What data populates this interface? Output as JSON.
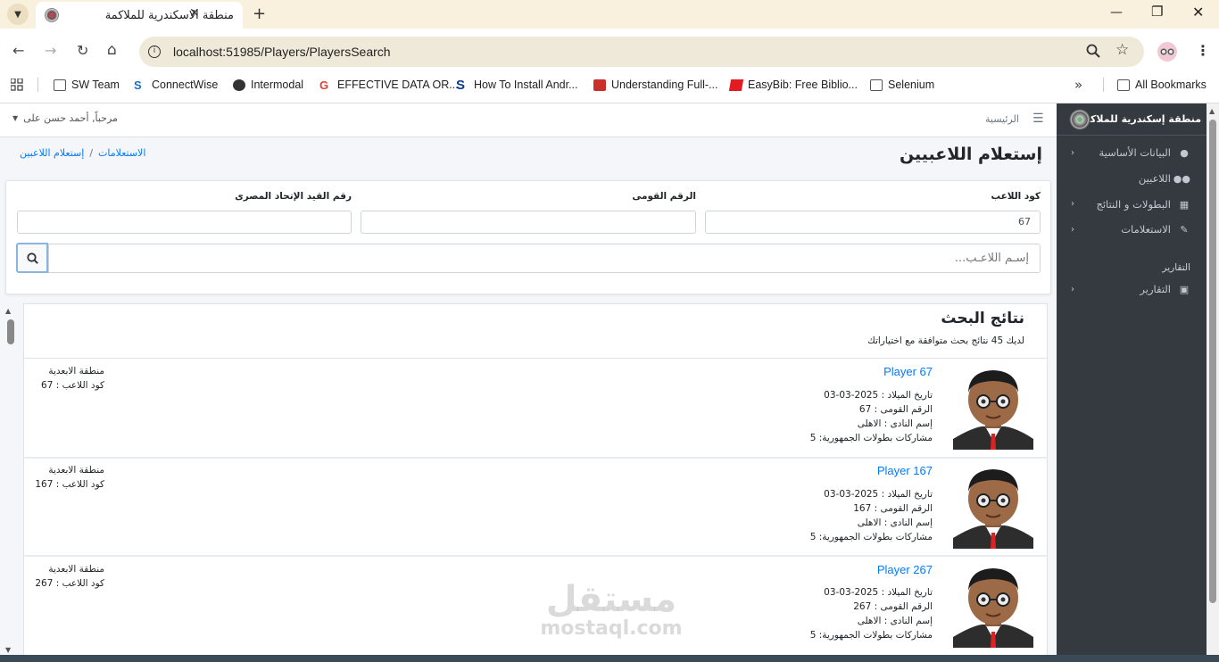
{
  "browser": {
    "tab_title": "منطقة الاسكندرية للملاكمة",
    "url": "localhost:51985/Players/PlayersSearch",
    "bookmarks": [
      "SW Team",
      "ConnectWise",
      "Intermodal",
      "EFFECTIVE DATA OR...",
      "How To Install Andr...",
      "Understanding Full-...",
      "EasyBib: Free Biblio...",
      "Selenium"
    ],
    "all_bookmarks": "All Bookmarks"
  },
  "sidebar": {
    "brand": "منطقة إسكندرية للملاكمة",
    "items": [
      {
        "label": "البيانات الأساسية",
        "icon": "dashboard-icon",
        "has_children": true
      },
      {
        "label": "اللاعبين",
        "icon": "users-icon",
        "has_children": false
      },
      {
        "label": "البطولات و النتائج",
        "icon": "table-icon",
        "has_children": true
      },
      {
        "label": "الاستعلامات",
        "icon": "edit-icon",
        "has_children": true
      }
    ],
    "reports_header": "التقارير",
    "reports_item": {
      "label": "التقارير",
      "icon": "book-icon"
    }
  },
  "topnav": {
    "home": "الرئيسية",
    "user_greeting": "مرحباً, أحمد حسن على"
  },
  "page": {
    "title": "إستعلام اللاعبيين",
    "breadcrumb": [
      "الاستعلامات",
      "إستعلام اللاعبين"
    ],
    "breadcrumb_sep": "/"
  },
  "search": {
    "player_code_label": "كود اللاعب",
    "player_code_value": "67",
    "national_id_label": "الرقم القومى",
    "national_id_value": "",
    "federation_label": "رقم القيد الإتحاد المصرى",
    "federation_value": "",
    "name_placeholder": "إسـم اللاعـب..."
  },
  "results": {
    "title": "نتائج البحث",
    "count_text": "لديك 45 نتائج بحث متوافقة مع اختياراتك",
    "players": [
      {
        "name": "Player 67",
        "dob": "تاريخ الميلاد : 2025-03-03",
        "national": "الرقم القومى : 67",
        "club": "إسم النادى : الاهلى",
        "participations": "مشاركات بطولات الجمهورية: 5",
        "region": "منطقة الابعدية",
        "code": "كود اللاعب : 67"
      },
      {
        "name": "Player 167",
        "dob": "تاريخ الميلاد : 2025-03-03",
        "national": "الرقم القومى : 167",
        "club": "إسم النادى : الاهلى",
        "participations": "مشاركات بطولات الجمهورية: 5",
        "region": "منطقة الابعدية",
        "code": "كود اللاعب : 167"
      },
      {
        "name": "Player 267",
        "dob": "تاريخ الميلاد : 2025-03-03",
        "national": "الرقم القومى : 267",
        "club": "إسم النادى : الاهلى",
        "participations": "مشاركات بطولات الجمهورية: 5",
        "region": "منطقة الابعدية",
        "code": "كود اللاعب : 267"
      }
    ]
  },
  "watermark": {
    "arabic": "مستقل",
    "latin": "mostaql.com"
  }
}
